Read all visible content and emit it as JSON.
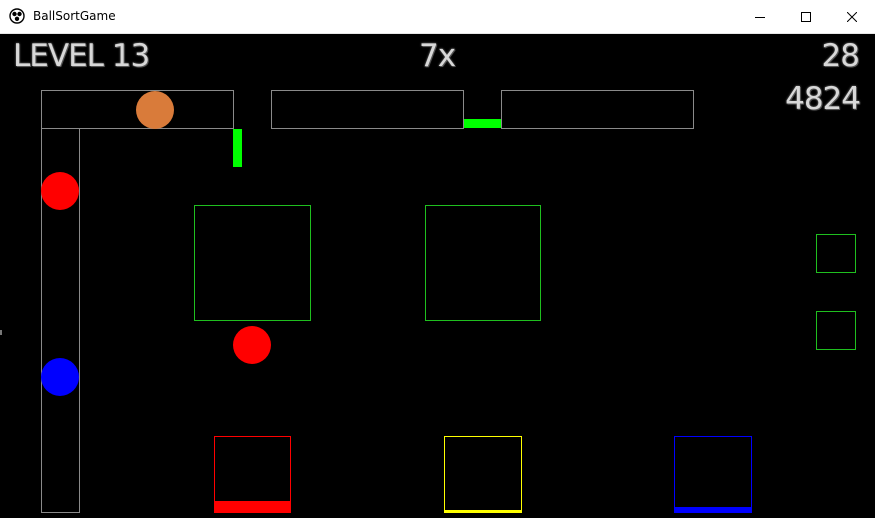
{
  "window": {
    "title": "BallSortGame",
    "app_icon": "ball-sort-game-icon",
    "controls": {
      "minimize": "minimize-icon",
      "maximize": "maximize-icon",
      "close": "close-icon"
    }
  },
  "hud": {
    "level": "LEVEL 13",
    "multiplier": "7x",
    "moves": "28",
    "score": "4824"
  },
  "colors": {
    "track": "#8a8a8a",
    "target": "#1fbf1f",
    "gate": "#00ff00",
    "ball_orange": "#d97b3a",
    "ball_red": "#ff0000",
    "ball_blue": "#0000ff",
    "bin_red": "#ff0000",
    "bin_yellow": "#ffff00",
    "bin_blue": "#0000ff"
  },
  "balls": [
    {
      "name": "ball-orange",
      "color": "orange"
    },
    {
      "name": "ball-red-track",
      "color": "red"
    },
    {
      "name": "ball-red-falling",
      "color": "red"
    },
    {
      "name": "ball-blue-track",
      "color": "blue"
    }
  ],
  "bins": [
    {
      "name": "bin-red",
      "color": "red",
      "fill_level": 0.16
    },
    {
      "name": "bin-yellow",
      "color": "yellow",
      "fill_level": 0.04
    },
    {
      "name": "bin-blue",
      "color": "blue",
      "fill_level": 0.08
    }
  ]
}
